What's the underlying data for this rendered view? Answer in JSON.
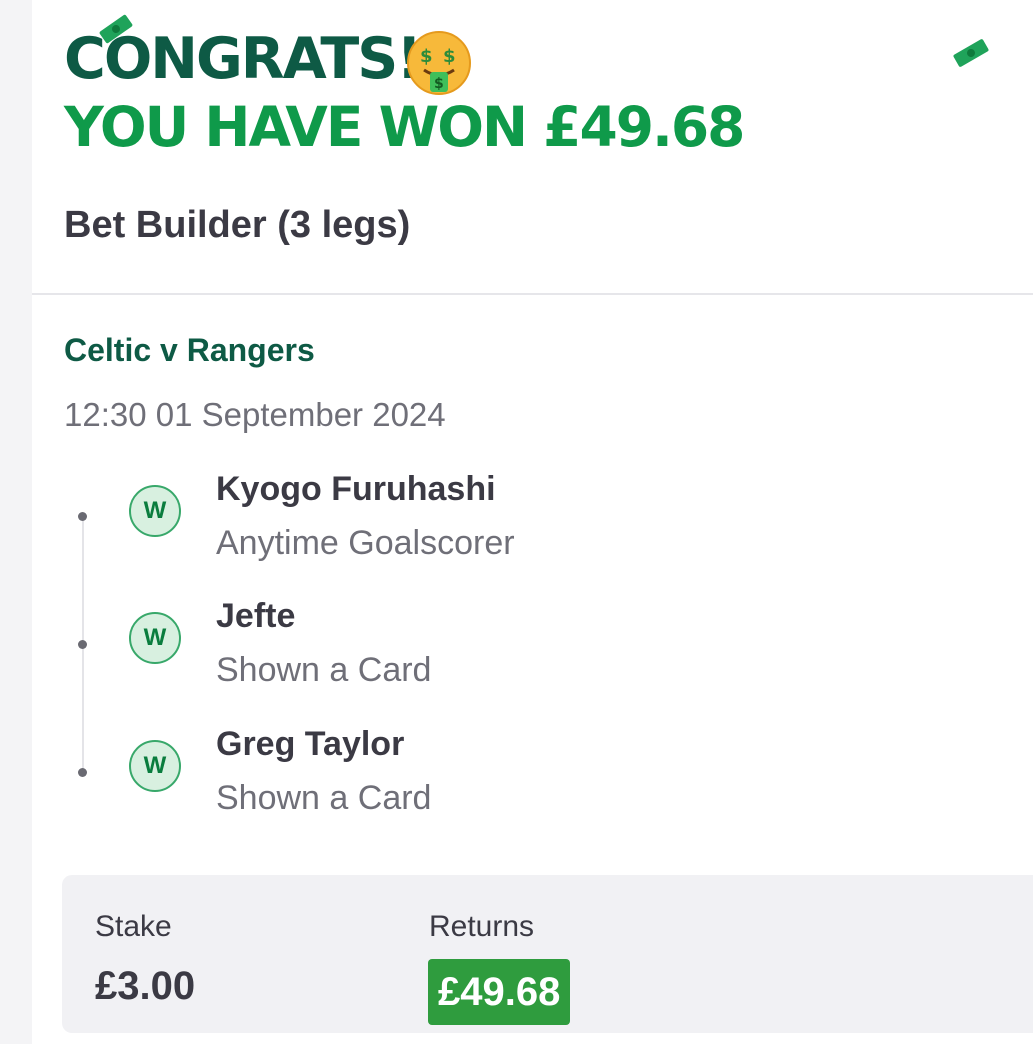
{
  "header": {
    "congrats": "CONGRATS!",
    "won_text": "YOU HAVE WON £49.68"
  },
  "bet": {
    "type_label": "Bet Builder (3 legs)",
    "event": "Celtic v Rangers",
    "datetime": "12:30 01 September 2024",
    "legs": [
      {
        "status": "W",
        "selection": "Kyogo Furuhashi",
        "market": "Anytime Goalscorer"
      },
      {
        "status": "W",
        "selection": "Jefte",
        "market": "Shown a Card"
      },
      {
        "status": "W",
        "selection": "Greg Taylor",
        "market": "Shown a Card"
      }
    ]
  },
  "summary": {
    "stake_label": "Stake",
    "stake_value": "£3.00",
    "returns_label": "Returns",
    "returns_value": "£49.68"
  },
  "icons": {
    "celebration_emoji": "money-mouth-face-icon",
    "decoration": "banknote-icon",
    "leg_status": "win-badge"
  },
  "colors": {
    "brand_dark_green": "#0e5a45",
    "win_green": "#0f9a4a",
    "returns_bg": "#2f9c3e",
    "text_dark": "#3b3a44",
    "text_muted": "#6f6f78"
  }
}
